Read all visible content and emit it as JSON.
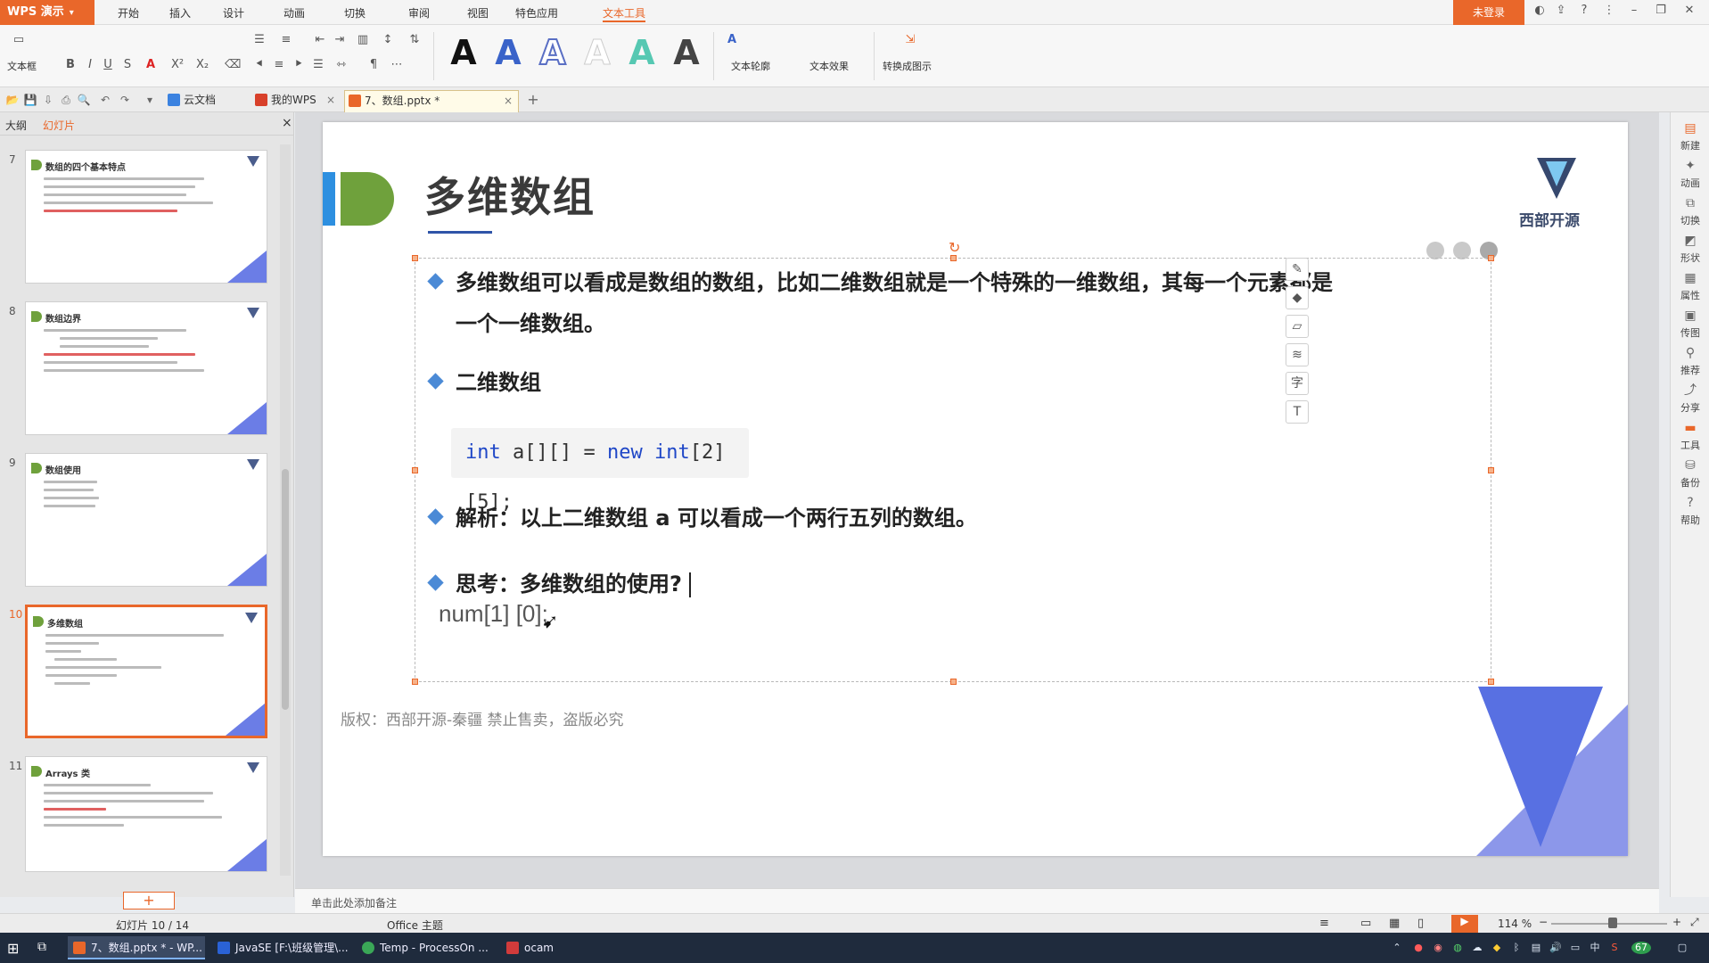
{
  "app": {
    "logo_label": "WPS 演示",
    "logo_caret": "▾",
    "menu": [
      "开始",
      "插入",
      "设计",
      "动画",
      "切换",
      "审阅",
      "视图",
      "特色应用",
      "文本工具"
    ],
    "login": "未登录"
  },
  "ribbon": {
    "textbox_label": "文本框",
    "bold": "B",
    "italic": "I",
    "underline": "U",
    "strike": "S",
    "fontcolor": "A",
    "sup": "X²",
    "sub": "X₂",
    "art_letters": [
      "A",
      "A",
      "A",
      "A",
      "A",
      "A"
    ],
    "outline_label": "文本轮廓",
    "effect_label": "文本效果",
    "smartart_label": "转换成图示"
  },
  "tabs": {
    "cloud": "云文档",
    "mywps": "我的WPS",
    "doc": "7、数组.pptx *",
    "close": "×",
    "add": "+"
  },
  "left_panel": {
    "tab_outline": "大纲",
    "tab_slides": "幻灯片",
    "close": "×",
    "add_slide": "+",
    "thumbs": [
      {
        "num": "7",
        "title": "数组的四个基本特点"
      },
      {
        "num": "8",
        "title": "数组边界"
      },
      {
        "num": "9",
        "title": "数组使用"
      },
      {
        "num": "10",
        "title": "多维数组"
      },
      {
        "num": "11",
        "title": "Arrays 类"
      }
    ]
  },
  "slide": {
    "title": "多维数组",
    "logo_text": "西部开源",
    "bullet1_line1": "多维数组可以看成是数组的数组，比如二维数组就是一个特殊的一维数组，其每一个元素都是",
    "bullet1_line2": "一个一维数组。",
    "bullet2": "二维数组",
    "code_kw1": "int",
    "code_mid": " a[][] = ",
    "code_kw2": "new",
    "code_kw3": " int",
    "code_tail": "[2][5];",
    "bullet3": "解析：以上二维数组 a 可以看成一个两行五列的数组。",
    "bullet4": "思考：多维数组的使用?",
    "num_text": "num[1] [0];",
    "footer": "版权：西部开源-秦疆    禁止售卖，盗版必究"
  },
  "right_tools": [
    "新建",
    "动画",
    "切换",
    "形状",
    "属性",
    "传图",
    "推荐",
    "分享",
    "工具",
    "备份",
    "帮助"
  ],
  "notes_placeholder": "单击此处添加备注",
  "status": {
    "slide_index": "幻灯片 10 / 14",
    "theme": "Office 主题",
    "zoom": "114 %"
  },
  "taskbar": {
    "items": [
      "7、数组.pptx * - WP...",
      "JavaSE [F:\\班级管理\\...",
      "Temp - ProcessOn ...",
      "ocam"
    ],
    "ime": "中",
    "badge": "67"
  },
  "colors": {
    "accent": "#e9672a",
    "slide_blue": "#4b8ad6",
    "title_green": "#6fa13c"
  }
}
